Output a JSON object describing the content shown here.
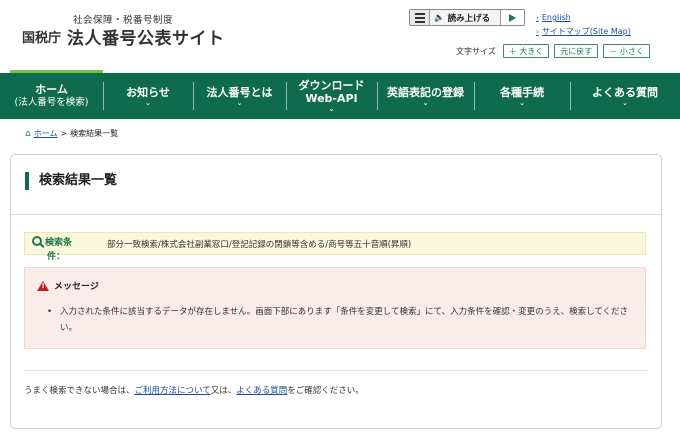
{
  "header": {
    "subtitle": "社会保障・税番号制度",
    "agency": "国税庁",
    "site_name": "法人番号公表サイト",
    "read_aloud_label": "読み上げる",
    "links": [
      {
        "label": "English"
      },
      {
        "label": "サイトマップ(Site Map)"
      }
    ],
    "font_size": {
      "label": "文字サイズ",
      "larger": "＋ 大きく",
      "reset": "元に戻す",
      "smaller": "－ 小さく"
    }
  },
  "nav": {
    "items": [
      {
        "line1": "ホーム",
        "line2": "(法人番号を検索)"
      },
      {
        "line1": "お知らせ",
        "line2": ""
      },
      {
        "line1": "法人番号とは",
        "line2": ""
      },
      {
        "line1": "ダウンロード",
        "line2": "Web-API"
      },
      {
        "line1": "英語表記の登録",
        "line2": ""
      },
      {
        "line1": "各種手続",
        "line2": ""
      },
      {
        "line1": "よくある質問",
        "line2": ""
      }
    ]
  },
  "breadcrumb": {
    "home": "ホーム",
    "separator": ">",
    "current": "検索結果一覧"
  },
  "main": {
    "title": "検索結果一覧",
    "condition_label_1": "検索条",
    "condition_label_2": "件：",
    "condition_value": "部分一致検索/株式会社副業窓口/登記記録の閉鎖等含める/商号等五十音順(昇順)",
    "message_title": "メッセージ",
    "message_text": "入力された条件に該当するデータが存在しません。画面下部にあります「条件を変更して検索」にて、入力条件を確認・変更のうえ、検索してください。",
    "footer_prefix": "うまく検索できない場合は、",
    "footer_link1": "ご利用方法について",
    "footer_mid": "又は、",
    "footer_link2": "よくある質問",
    "footer_suffix": "をご確認ください。"
  },
  "colors": {
    "nav_bg": "#0f6b4e",
    "nav_accent": "#7cc04a",
    "link": "#1a4fa0",
    "warning": "#c41e1e",
    "condition_bg": "#fbf7dc",
    "message_bg": "#fbebeb"
  }
}
